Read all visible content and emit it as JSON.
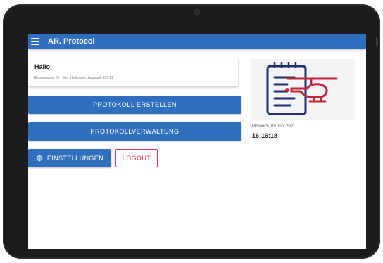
{
  "app": {
    "title": "AR. Protocol"
  },
  "welcome": {
    "title": "Hallo!",
    "subtitle": "Einsatzbasis 23 - Biel, Helikopter: Agusta A 109 K2"
  },
  "actions": {
    "create_protocol": "PROTOKOLL ERSTELLEN",
    "manage_protocols": "PROTOKOLLVERWALTUNG",
    "settings": "EINSTELLUNGEN",
    "logout": "LOGOUT"
  },
  "info": {
    "date": "Mittwoch, 09 Juni 2021",
    "time": "16:16:18"
  },
  "icons": {
    "menu": "hamburger-menu-icon",
    "settings": "gear-icon",
    "illustration": "clipboard-helicopter-icon"
  },
  "colors": {
    "primary": "#2f6fbe",
    "danger": "#e0364f",
    "illustration_navy": "#1f2f6e",
    "illustration_red": "#c0273a"
  }
}
